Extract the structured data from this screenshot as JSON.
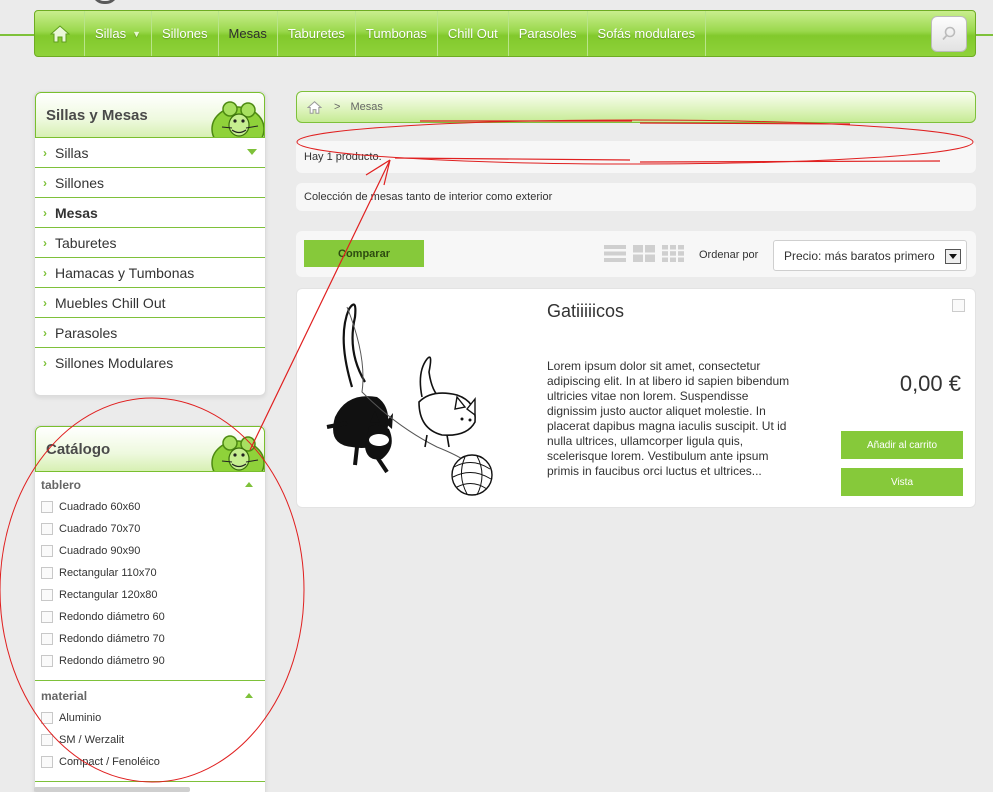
{
  "nav": {
    "items": [
      {
        "label": "Sillas",
        "dropdown": true
      },
      {
        "label": "Sillones"
      },
      {
        "label": "Mesas",
        "active": true
      },
      {
        "label": "Taburetes"
      },
      {
        "label": "Tumbonas"
      },
      {
        "label": "Chill Out"
      },
      {
        "label": "Parasoles"
      },
      {
        "label": "Sofás modulares"
      }
    ],
    "home_icon": "home-icon",
    "search_icon": "search-icon"
  },
  "sidebar": {
    "categories_title": "Sillas y Mesas",
    "categories": [
      {
        "label": "Sillas",
        "expandable": true
      },
      {
        "label": "Sillones"
      },
      {
        "label": "Mesas",
        "active": true
      },
      {
        "label": "Taburetes"
      },
      {
        "label": "Hamacas y Tumbonas"
      },
      {
        "label": "Muebles Chill Out"
      },
      {
        "label": "Parasoles"
      },
      {
        "label": "Sillones Modulares"
      }
    ],
    "catalog_title": "Catálogo",
    "filters": [
      {
        "name": "tablero",
        "options": [
          "Cuadrado 60x60",
          "Cuadrado 70x70",
          "Cuadrado 90x90",
          "Rectangular 110x70",
          "Rectangular 120x80",
          "Redondo diámetro 60",
          "Redondo diámetro 70",
          "Redondo diámetro 90"
        ]
      },
      {
        "name": "material",
        "options": [
          "Aluminio",
          "SM / Werzalit",
          "Compact / Fenoléico"
        ]
      }
    ]
  },
  "breadcrumb": {
    "separator": ">",
    "current": "Mesas"
  },
  "results": {
    "count_text": "Hay 1 producto."
  },
  "category_description": "Colección de mesas tanto de interior como exterior",
  "toolbar": {
    "compare_label": "Comparar",
    "sort_label": "Ordenar por",
    "sort_value": "Precio: más baratos primero"
  },
  "product": {
    "name": "Gatiiiiicos",
    "description": "Lorem ipsum dolor sit amet, consectetur adipiscing elit. In at libero id sapien bibendum ultricies vitae non lorem. Suspendisse dignissim justo auctor aliquet molestie. In placerat dapibus magna iaculis suscipit. Ut id nulla ultrices, ullamcorper ligula quis, scelerisque lorem. Vestibulum ante ipsum primis in faucibus orci luctus et ultrices...",
    "price": "0,00 €",
    "add_to_cart_label": "Añadir al carrito",
    "view_label": "Vista"
  },
  "colors": {
    "accent": "#86c93a",
    "annotation": "#e02020"
  }
}
